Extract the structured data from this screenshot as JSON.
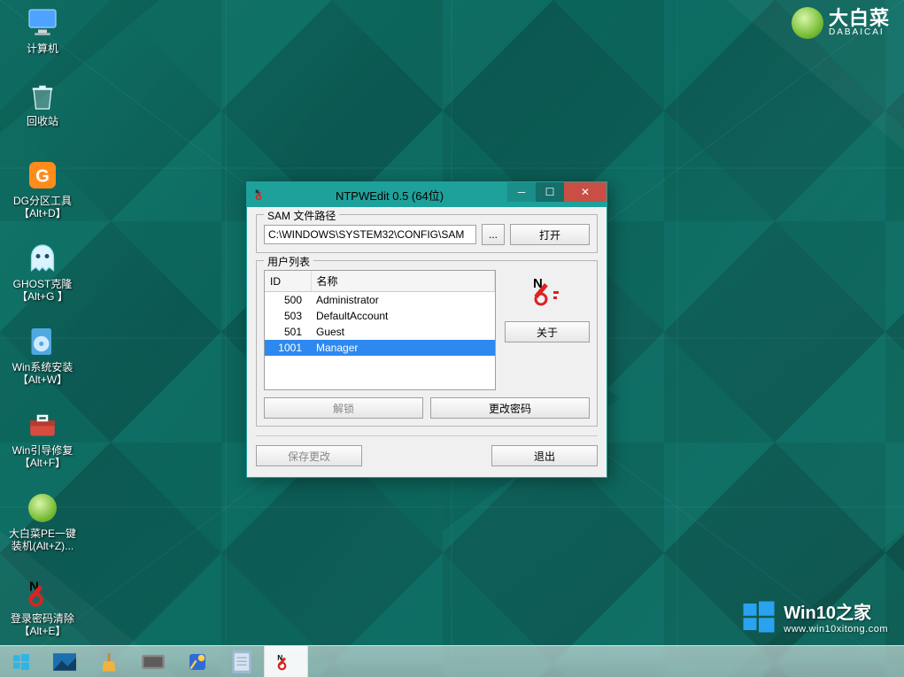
{
  "brand": {
    "cn": "大白菜",
    "en": "DABAICAI"
  },
  "watermark": {
    "title": "Win10之家",
    "url": "www.win10xitong.com"
  },
  "desktop_icons": [
    {
      "label": "计算机"
    },
    {
      "label": "回收站"
    },
    {
      "label": "DG分区工具\n【Alt+D】"
    },
    {
      "label": "GHOST克隆\n【Alt+G 】"
    },
    {
      "label": "Win系统安装\n【Alt+W】"
    },
    {
      "label": "Win引导修复\n【Alt+F】"
    },
    {
      "label": "大白菜PE一键\n装机(Alt+Z)..."
    },
    {
      "label": "登录密码清除\n【Alt+E】"
    }
  ],
  "window": {
    "title": "NTPWEdit 0.5 (64位)",
    "sam_group": "SAM 文件路径",
    "sam_path": "C:\\WINDOWS\\SYSTEM32\\CONFIG\\SAM",
    "browse": "...",
    "open": "打开",
    "userlist_group": "用户列表",
    "columns": {
      "id": "ID",
      "name": "名称"
    },
    "users": [
      {
        "id": "500",
        "name": "Administrator",
        "selected": false
      },
      {
        "id": "503",
        "name": "DefaultAccount",
        "selected": false
      },
      {
        "id": "501",
        "name": "Guest",
        "selected": false
      },
      {
        "id": "1001",
        "name": "Manager",
        "selected": true
      }
    ],
    "about": "关于",
    "unlock": "解锁",
    "changepw": "更改密码",
    "save": "保存更改",
    "exit": "退出"
  },
  "taskbar": {
    "items": [
      "desktop-peek",
      "cleanup",
      "hardware",
      "tweak",
      "notepad",
      "ntpwedit"
    ],
    "active": "ntpwedit"
  }
}
